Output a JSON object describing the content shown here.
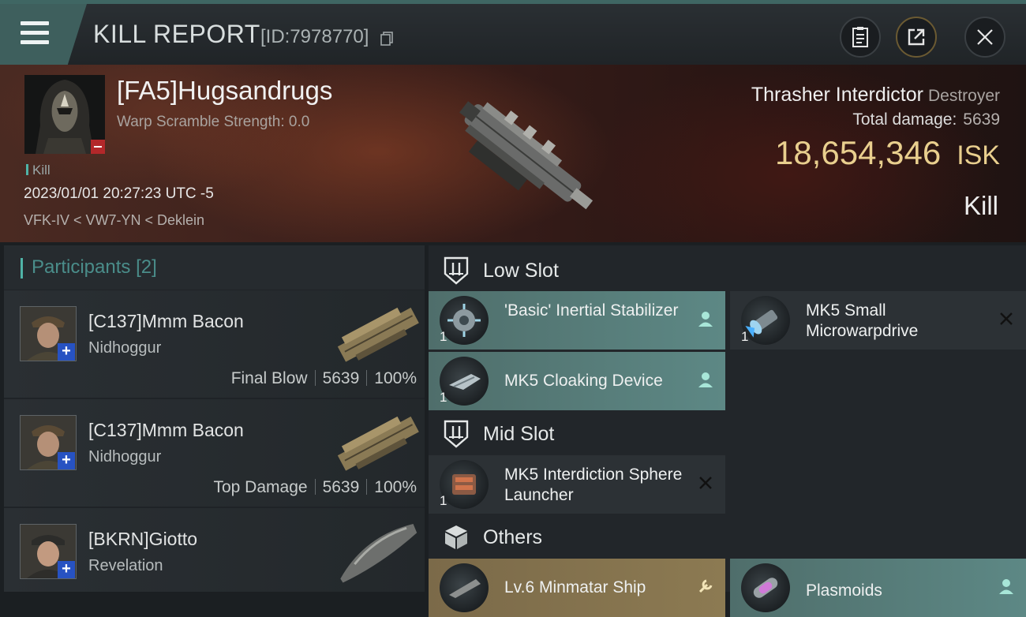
{
  "header": {
    "title": "KILL REPORT",
    "report_id": "[ID:7978770]",
    "icons": [
      "menu-icon",
      "copy-icon",
      "clipboard-icon",
      "share-icon",
      "close-icon"
    ]
  },
  "victim": {
    "name": "[FA5]Hugsandrugs",
    "warp_scramble": "Warp Scramble Strength: 0.0",
    "tag": "Kill",
    "datetime": "2023/01/01 20:27:23 UTC -5",
    "location": "VFK-IV < VW7-YN < Deklein",
    "ship_name": "Thrasher Interdictor",
    "ship_class": "Destroyer",
    "total_damage_label": "Total damage:",
    "total_damage": "5639",
    "isk_value": "18,654,346",
    "isk_unit": "ISK",
    "result": "Kill"
  },
  "participants": {
    "title": "Participants",
    "count": "[2]",
    "rows": [
      {
        "name": "[C137]Mmm Bacon",
        "ship": "Nidhoggur",
        "role": "Final Blow",
        "damage": "5639",
        "percent": "100%"
      },
      {
        "name": "[C137]Mmm Bacon",
        "ship": "Nidhoggur",
        "role": "Top Damage",
        "damage": "5639",
        "percent": "100%"
      },
      {
        "name": "[BKRN]Giotto",
        "ship": "Revelation"
      }
    ]
  },
  "slots": {
    "low": {
      "title": "Low Slot",
      "modules": [
        {
          "name": "'Basic' Inertial Stabilizer",
          "qty": "1",
          "state": "dropped"
        },
        {
          "name": "MK5 Small Microwarpdrive",
          "qty": "1",
          "state": "destroyed"
        },
        {
          "name": "MK5 Cloaking Device",
          "qty": "1",
          "state": "dropped"
        }
      ]
    },
    "mid": {
      "title": "Mid Slot",
      "modules": [
        {
          "name": "MK5 Interdiction Sphere Launcher",
          "qty": "1",
          "state": "destroyed"
        }
      ]
    },
    "others": {
      "title": "Others",
      "modules": [
        {
          "name": "Lv.6 Minmatar Ship",
          "state": "repair"
        },
        {
          "name": "Plasmoids",
          "state": "dropped"
        }
      ]
    }
  },
  "colors": {
    "accent_teal": "#4fb3a7",
    "isk_gold": "#e9cf8e",
    "dropped_bg": "#5d8885",
    "destroyed_bg": "#2c3135",
    "repair_bg": "#8c7a52",
    "minus_badge": "#b3282a",
    "plus_badge": "#2752c2"
  }
}
